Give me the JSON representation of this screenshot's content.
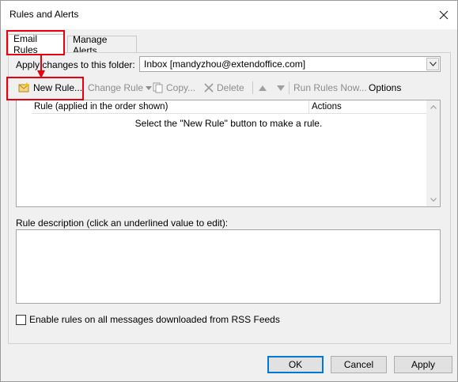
{
  "window": {
    "title": "Rules and Alerts"
  },
  "tabs": [
    {
      "label": "Email Rules",
      "active": true
    },
    {
      "label": "Manage Alerts",
      "active": false
    }
  ],
  "folder": {
    "label": "Apply changes to this folder:",
    "value": "Inbox [mandyzhou@extendoffice.com]"
  },
  "toolbar": {
    "new_rule": "New Rule...",
    "change_rule": "Change Rule",
    "copy": "Copy...",
    "delete": "Delete",
    "run_rules_now": "Run Rules Now...",
    "options": "Options"
  },
  "rules_list": {
    "columns": [
      "Rule (applied in the order shown)",
      "Actions"
    ],
    "empty_message": "Select the \"New Rule\" button to make a rule."
  },
  "description": {
    "label": "Rule description (click an underlined value to edit):"
  },
  "rss": {
    "label": "Enable rules on all messages downloaded from RSS Feeds",
    "checked": false
  },
  "buttons": {
    "ok": "OK",
    "cancel": "Cancel",
    "apply": "Apply"
  },
  "colors": {
    "highlight": "#e8000f",
    "focus_border": "#0078d7",
    "dialog_bg": "#f0f0f0"
  }
}
